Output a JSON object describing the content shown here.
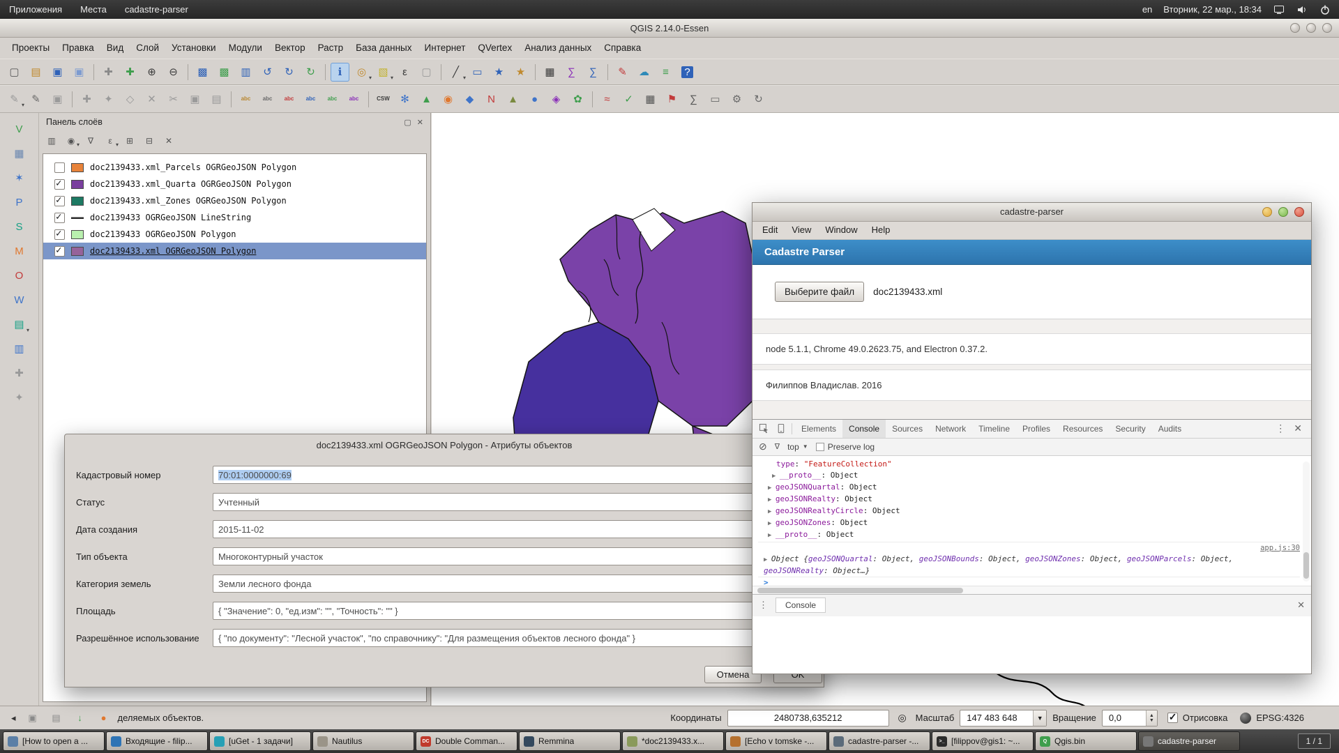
{
  "desktop_panel": {
    "menus": [
      "Приложения",
      "Места",
      "cadastre-parser"
    ],
    "keyboard_layout": "en",
    "clock": "Вторник, 22 мар., 18:34"
  },
  "qgis": {
    "title": "QGIS 2.14.0-Essen",
    "menu": [
      "Проекты",
      "Правка",
      "Вид",
      "Слой",
      "Установки",
      "Модули",
      "Вектор",
      "Растр",
      "База данных",
      "Интернет",
      "QVertex",
      "Анализ данных",
      "Справка"
    ],
    "toolbar1": [
      {
        "n": "new-project-icon",
        "g": "▢",
        "c": "#5a5a5a"
      },
      {
        "n": "open-project-icon",
        "g": "▤",
        "c": "#c08a2f"
      },
      {
        "n": "save-project-icon",
        "g": "▣",
        "c": "#2f62b8"
      },
      {
        "n": "save-project-as-icon",
        "g": "▣",
        "c": "#7d9bd0"
      },
      {
        "sep": true
      },
      {
        "n": "pan-map-icon",
        "g": "✚",
        "c": "#8a8a8a"
      },
      {
        "n": "pan-to-selection-icon",
        "g": "✚",
        "c": "#3f9e4d"
      },
      {
        "n": "zoom-in-icon",
        "g": "⊕",
        "c": "#3b3b3b"
      },
      {
        "n": "zoom-out-icon",
        "g": "⊖",
        "c": "#3b3b3b"
      },
      {
        "sep": true
      },
      {
        "n": "zoom-full-icon",
        "g": "▩",
        "c": "#2f62b8"
      },
      {
        "n": "zoom-to-selection-icon",
        "g": "▩",
        "c": "#3f9e4d"
      },
      {
        "n": "zoom-to-layer-icon",
        "g": "▥",
        "c": "#2f62b8"
      },
      {
        "n": "zoom-last-icon",
        "g": "↺",
        "c": "#2f62b8"
      },
      {
        "n": "zoom-next-icon",
        "g": "↻",
        "c": "#2f62b8"
      },
      {
        "n": "refresh-map-icon",
        "g": "↻",
        "c": "#3f9e4d"
      },
      {
        "sep": true
      },
      {
        "n": "identify-features-icon",
        "g": "ℹ",
        "c": "#2f62b8",
        "active": true
      },
      {
        "n": "run-feature-action-icon",
        "g": "◎",
        "c": "#c08a2f",
        "arrow": true
      },
      {
        "n": "select-features-icon",
        "g": "▧",
        "c": "#c2b22f",
        "arrow": true
      },
      {
        "n": "select-by-expression-icon",
        "g": "ε",
        "c": "#3b3b3b"
      },
      {
        "n": "deselect-all-icon",
        "g": "▢",
        "c": "#9a9a9a"
      },
      {
        "sep": true
      },
      {
        "n": "measure-icon",
        "g": "╱",
        "c": "#3b3b3b",
        "arrow": true
      },
      {
        "n": "map-tips-icon",
        "g": "▭",
        "c": "#2f62b8"
      },
      {
        "n": "new-bookmark-icon",
        "g": "★",
        "c": "#2f62b8"
      },
      {
        "n": "show-bookmarks-icon",
        "g": "★",
        "c": "#c08a2f"
      },
      {
        "sep": true
      },
      {
        "n": "attribute-table-icon",
        "g": "▦",
        "c": "#3b3b3b"
      },
      {
        "n": "field-calculator-icon",
        "g": "∑",
        "c": "#8a2fb8"
      },
      {
        "n": "statistical-summary-icon",
        "g": "∑",
        "c": "#2f62b8"
      },
      {
        "sep": true
      },
      {
        "n": "annotation-icon",
        "g": "✎",
        "c": "#c23b3b"
      },
      {
        "n": "web-services-icon",
        "g": "☁",
        "c": "#2f8ab8"
      },
      {
        "n": "python-console-icon",
        "g": "≡",
        "c": "#3f9e4d"
      },
      {
        "n": "help-contents-icon",
        "g": "?",
        "c": "#ffffff",
        "bg": "#2f62b8"
      }
    ],
    "toolbar2": [
      {
        "n": "current-edits-icon",
        "g": "✎",
        "c": "#9a9a9a",
        "arrow": true
      },
      {
        "n": "toggle-editing-icon",
        "g": "✎",
        "c": "#6a6a6a"
      },
      {
        "n": "save-layer-edits-icon",
        "g": "▣",
        "c": "#9a9a9a"
      },
      {
        "sep": true
      },
      {
        "n": "add-feature-icon",
        "g": "✚",
        "c": "#9a9a9a"
      },
      {
        "n": "move-feature-icon",
        "g": "✦",
        "c": "#9a9a9a"
      },
      {
        "n": "node-tool-icon",
        "g": "◇",
        "c": "#9a9a9a"
      },
      {
        "n": "delete-selected-icon",
        "g": "✕",
        "c": "#9a9a9a"
      },
      {
        "n": "cut-features-icon",
        "g": "✂",
        "c": "#9a9a9a"
      },
      {
        "n": "copy-features-icon",
        "g": "▣",
        "c": "#9a9a9a"
      },
      {
        "n": "paste-features-icon",
        "g": "▤",
        "c": "#9a9a9a"
      },
      {
        "sep": true
      },
      {
        "n": "label-settings-icon",
        "g": "abc",
        "c": "#b8862f",
        "sm": true
      },
      {
        "n": "label-pin-icon",
        "g": "abc",
        "c": "#6a6a6a",
        "sm": true
      },
      {
        "n": "label-highlight-icon",
        "g": "abc",
        "c": "#c23b3b",
        "sm": true
      },
      {
        "n": "label-move-icon",
        "g": "abc",
        "c": "#2f62b8",
        "sm": true
      },
      {
        "n": "label-rotate-icon",
        "g": "abc",
        "c": "#3f9e4d",
        "sm": true
      },
      {
        "n": "label-properties-icon",
        "g": "abc",
        "c": "#8a2fb8",
        "sm": true
      },
      {
        "sep": true
      },
      {
        "n": "csw-search-icon",
        "g": "CSW",
        "c": "#3b3b3b",
        "sm": true
      },
      {
        "n": "openlayers-plugin-icon",
        "g": "✻",
        "c": "#3f74c9"
      },
      {
        "n": "qtiles-icon",
        "g": "▲",
        "c": "#3f9e4d"
      },
      {
        "n": "heatmap-icon",
        "g": "◉",
        "c": "#e0782f"
      },
      {
        "n": "interpolation-icon",
        "g": "◆",
        "c": "#3f74c9"
      },
      {
        "n": "numerical-digitize-icon",
        "g": "N",
        "c": "#c23b3b"
      },
      {
        "n": "profile-tool-icon",
        "g": "▲",
        "c": "#7a8a3f"
      },
      {
        "n": "point-sampling-icon",
        "g": "●",
        "c": "#3f74c9"
      },
      {
        "n": "spatial-query-icon",
        "g": "◈",
        "c": "#8a2fb8"
      },
      {
        "n": "grass-plugin-icon",
        "g": "✿",
        "c": "#3f9e4d"
      },
      {
        "sep": true
      },
      {
        "n": "road-graph-icon",
        "g": "≈",
        "c": "#c23b3b"
      },
      {
        "n": "topology-checker-icon",
        "g": "✓",
        "c": "#3f9e4d"
      },
      {
        "n": "zonal-statistics-icon",
        "g": "▦",
        "c": "#555555"
      },
      {
        "n": "pin-labels-icon",
        "g": "⚑",
        "c": "#c23b3b"
      },
      {
        "n": "statist-plugin-icon",
        "g": "∑",
        "c": "#555555"
      },
      {
        "n": "dxf-export-icon",
        "g": "▭",
        "c": "#6a6a6a"
      },
      {
        "n": "plugin-settings-icon",
        "g": "⚙",
        "c": "#6a6a6a"
      },
      {
        "n": "reload-plugins-icon",
        "g": "↻",
        "c": "#6a6a6a"
      }
    ],
    "left_toolbar": [
      {
        "n": "add-vector-layer-icon",
        "g": "V",
        "c": "#3f9e4d"
      },
      {
        "n": "add-raster-layer-icon",
        "g": "▦",
        "c": "#6a87b0"
      },
      {
        "n": "add-delimited-text-icon",
        "g": "✶",
        "c": "#3f74c9"
      },
      {
        "n": "add-postgis-layer-icon",
        "g": "P",
        "c": "#3f74c9"
      },
      {
        "n": "add-spatialite-layer-icon",
        "g": "S",
        "c": "#16a085"
      },
      {
        "n": "add-mssql-layer-icon",
        "g": "M",
        "c": "#e0782f"
      },
      {
        "n": "add-oracle-layer-icon",
        "g": "O",
        "c": "#c23b3b"
      },
      {
        "n": "add-wms-layer-icon",
        "g": "W",
        "c": "#3f74c9"
      },
      {
        "n": "add-wcs-layer-icon",
        "g": "▤",
        "c": "#16a085",
        "arrow": true
      },
      {
        "n": "add-wfs-layer-icon",
        "g": "▥",
        "c": "#3f74c9"
      },
      {
        "n": "new-shapefile-layer-icon",
        "g": "✚",
        "c": "#9a9a9a"
      },
      {
        "n": "new-spatialite-layer-icon",
        "g": "✦",
        "c": "#9a9a9a"
      }
    ],
    "layers_panel": {
      "title": "Панель слоёв",
      "toolbar": [
        {
          "n": "open-layer-styling-icon",
          "g": "▥",
          "c": "#555555"
        },
        {
          "n": "manage-map-themes-icon",
          "g": "◉",
          "c": "#555555",
          "arrow": true
        },
        {
          "n": "filter-legend-icon",
          "g": "∇",
          "c": "#555555"
        },
        {
          "n": "filter-by-expression-icon",
          "g": "ε",
          "c": "#555555",
          "arrow": true
        },
        {
          "n": "expand-all-icon",
          "g": "⊞",
          "c": "#555555"
        },
        {
          "n": "collapse-all-icon",
          "g": "⊟",
          "c": "#555555"
        },
        {
          "n": "remove-layer-icon",
          "g": "✕",
          "c": "#555555"
        }
      ],
      "layers": [
        {
          "label": "doc2139433.xml_Parcels OGRGeoJSON Polygon",
          "swatch": "#e8833a"
        },
        {
          "label": "doc2139433.xml_Quarta OGRGeoJSON Polygon",
          "checked": true,
          "swatch": "#7a3f9e"
        },
        {
          "label": "doc2139433.xml_Zones OGRGeoJSON Polygon",
          "checked": true,
          "swatch": "#1d7a63"
        },
        {
          "label": "doc2139433 OGRGeoJSON LineString",
          "checked": true,
          "line": true
        },
        {
          "label": "doc2139433 OGRGeoJSON Polygon",
          "checked": true,
          "swatch": "#b9f0ae"
        },
        {
          "label": "doc2139433.xml OGRGeoJSON Polygon",
          "checked": true,
          "swatch": "#96639a",
          "active": true
        }
      ]
    },
    "attribute_dialog": {
      "title": "doc2139433.xml OGRGeoJSON Polygon - Атрибуты объектов",
      "fields": [
        {
          "label": "Кадастровый номер",
          "value": "70:01:0000000:69",
          "selected": true
        },
        {
          "label": "Статус",
          "value": "Учтенный"
        },
        {
          "label": "Дата создания",
          "value": "2015-11-02"
        },
        {
          "label": "Тип объекта",
          "value": "Многоконтурный участок"
        },
        {
          "label": "Категория земель",
          "value": "Земли лесного фонда"
        },
        {
          "label": "Площадь",
          "value": "{ \"Значение\": 0, \"ед.изм\": \"\", \"Точность\": \"\" }"
        },
        {
          "label": "Разрешённое использование",
          "value": "{ \"по документу\": \"Лесной участок\", \"по справочнику\": \"Для размещения объектов лесного фонда\" }"
        }
      ],
      "buttons": {
        "cancel": "Отмена",
        "ok": "OK"
      }
    },
    "status_bar": {
      "icons": [
        {
          "n": "messages-indicator-icon",
          "g": "▣",
          "c": "#8a8a8a"
        },
        {
          "n": "network-indicator-icon",
          "g": "▤",
          "c": "#8a8a8a"
        },
        {
          "n": "download-indicator-icon",
          "g": "↓",
          "c": "#3f9e4d"
        },
        {
          "n": "alert-indicator-icon",
          "g": "●",
          "c": "#e0782f"
        }
      ],
      "message": "деляемых объектов.",
      "coords_label": "Координаты",
      "coords_value": "2480738,635212",
      "scale_label": "Масштаб",
      "scale_value": "147 483 648",
      "rotation_label": "Вращение",
      "rotation_value": "0,0",
      "render_label": "Отрисовка",
      "crs_label": "EPSG:4326"
    }
  },
  "parser_app": {
    "title": "cadastre-parser",
    "menu": [
      "Edit",
      "View",
      "Window",
      "Help"
    ],
    "header": "Cadastre Parser",
    "file_button": "Выберите файл",
    "file_name": "doc2139433.xml",
    "info_line": "node 5.1.1, Chrome 49.0.2623.75, and Electron 0.37.2.",
    "author_line": "Филиппов Владислав. 2016",
    "devtools": {
      "tabs": [
        {
          "label": "Elements"
        },
        {
          "label": "Console",
          "active": true
        },
        {
          "label": "Sources"
        },
        {
          "label": "Network"
        },
        {
          "label": "Timeline"
        },
        {
          "label": "Profiles"
        },
        {
          "label": "Resources"
        },
        {
          "label": "Security"
        },
        {
          "label": "Audits"
        }
      ],
      "frame_selector": "top",
      "preserve_log": "Preserve log",
      "drawer_tab": "Console",
      "console_entries": [
        {
          "ind": 26,
          "segs": [
            {
              "c": "k",
              "t": "type"
            },
            {
              "c": "p",
              "t": ": "
            },
            {
              "c": "s",
              "t": "\"FeatureCollection\""
            }
          ]
        },
        {
          "ind": 20,
          "segs": [
            {
              "c": "a",
              "t": "▶ "
            },
            {
              "c": "k",
              "t": "__proto__"
            },
            {
              "c": "p",
              "t": ": Object"
            }
          ]
        },
        {
          "ind": 14,
          "segs": [
            {
              "c": "a",
              "t": "▶ "
            },
            {
              "c": "k",
              "t": "geoJSONQuartal"
            },
            {
              "c": "p",
              "t": ": Object"
            }
          ]
        },
        {
          "ind": 14,
          "segs": [
            {
              "c": "a",
              "t": "▶ "
            },
            {
              "c": "k",
              "t": "geoJSONRealty"
            },
            {
              "c": "p",
              "t": ": Object"
            }
          ]
        },
        {
          "ind": 14,
          "segs": [
            {
              "c": "a",
              "t": "▶ "
            },
            {
              "c": "k",
              "t": "geoJSONRealtyCircle"
            },
            {
              "c": "p",
              "t": ": Object"
            }
          ]
        },
        {
          "ind": 14,
          "segs": [
            {
              "c": "a",
              "t": "▶ "
            },
            {
              "c": "k",
              "t": "geoJSONZones"
            },
            {
              "c": "p",
              "t": ": Object"
            }
          ]
        },
        {
          "ind": 14,
          "segs": [
            {
              "c": "a",
              "t": "▶ "
            },
            {
              "c": "k",
              "t": "__proto__"
            },
            {
              "c": "p",
              "t": ": Object"
            }
          ]
        },
        {
          "linkline": true,
          "link": "app.js:30"
        },
        {
          "ind": 8,
          "segs": [
            {
              "c": "a",
              "t": "▶ "
            },
            {
              "c": "ip",
              "t": "Object {"
            },
            {
              "c": "ik",
              "t": "geoJSONQuartal"
            },
            {
              "c": "ip",
              "t": ": Object, "
            },
            {
              "c": "ik",
              "t": "geoJSONBounds"
            },
            {
              "c": "ip",
              "t": ": Object, "
            },
            {
              "c": "ik",
              "t": "geoJSONZones"
            },
            {
              "c": "ip",
              "t": ": Object, "
            },
            {
              "c": "ik",
              "t": "geoJSONParcels"
            },
            {
              "c": "ip",
              "t": ": Object, "
            },
            {
              "c": "ik",
              "t": "geoJSONRealty"
            },
            {
              "c": "ip",
              "t": ": Object…}"
            }
          ]
        },
        {
          "ind": 8,
          "border": true,
          "segs": [
            {
              "c": "prompt",
              "t": ">"
            }
          ]
        }
      ]
    }
  },
  "taskbar": {
    "buttons": [
      {
        "label": "[How to open a ...",
        "ic": "#5b7fa6"
      },
      {
        "label": "Входящие - filip...",
        "ic": "#2e74b5"
      },
      {
        "label": "[uGet - 1 задачи]",
        "ic": "#27a0b5"
      },
      {
        "label": "Nautilus",
        "ic": "#9a9488"
      },
      {
        "label": "Double Comman...",
        "ic": "#c0392b",
        "gl": "DC"
      },
      {
        "label": "Remmina",
        "ic": "#34495e"
      },
      {
        "label": "*doc2139433.x...",
        "ic": "#8a9a5b"
      },
      {
        "label": "[Echo v tomske -...",
        "ic": "#b5702e"
      },
      {
        "label": "cadastre-parser -...",
        "ic": "#5b6b7a"
      },
      {
        "label": "[filippov@gis1: ~...",
        "ic": "#2b2b2b",
        "gl": ">_"
      },
      {
        "label": "Qgis.bin",
        "ic": "#3f9e4d",
        "gl": "Q"
      },
      {
        "label": "cadastre-parser",
        "ic": "#777777",
        "active": true
      }
    ],
    "workspace": "1 / 1"
  }
}
